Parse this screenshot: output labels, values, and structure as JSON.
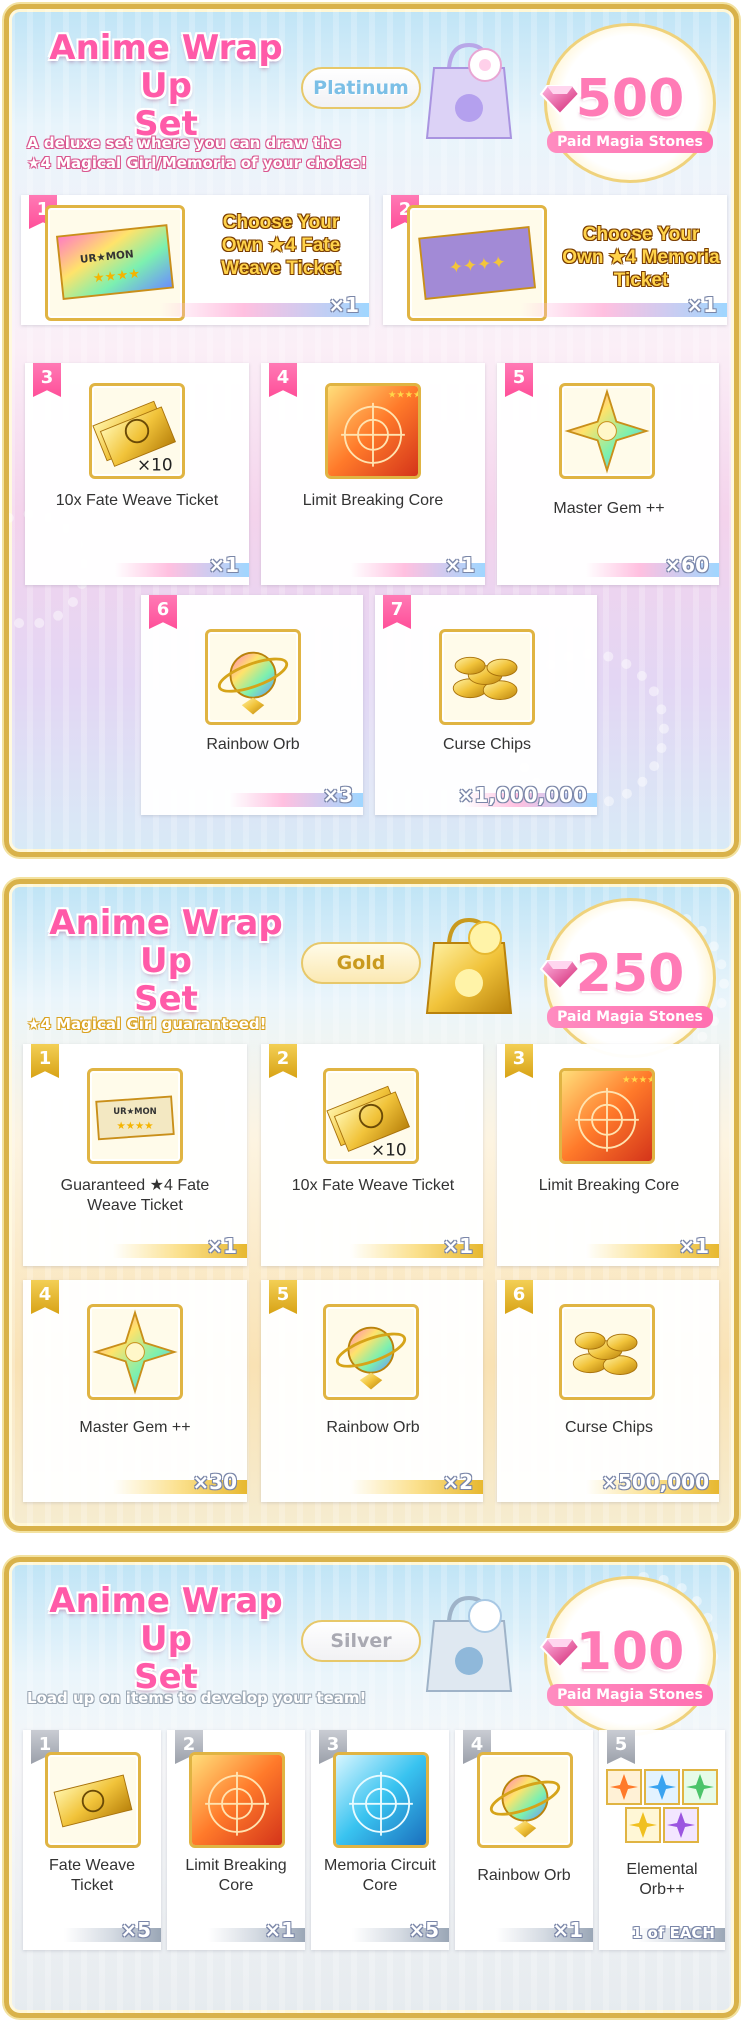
{
  "platinum": {
    "title_line1": "Anime Wrap Up",
    "title_line2": "Set",
    "tier": "Platinum",
    "price": "500",
    "price_label": "Paid Magia Stones",
    "description_line1": "A deluxe set where you can draw the",
    "description_line2": "★4 Magical Girl/Memoria of your choice!",
    "items": [
      {
        "num": "1",
        "label": "Choose Your Own ★4 Fate Weave Ticket",
        "qty": "×1"
      },
      {
        "num": "2",
        "label": "Choose Your Own ★4 Memoria Ticket",
        "qty": "×1"
      },
      {
        "num": "3",
        "label": "10x Fate Weave Ticket",
        "qty": "×1",
        "icon_badge": "×10"
      },
      {
        "num": "4",
        "label": "Limit Breaking Core",
        "qty": "×1"
      },
      {
        "num": "5",
        "label": "Master Gem ++",
        "qty": "×60"
      },
      {
        "num": "6",
        "label": "Rainbow Orb",
        "qty": "×3"
      },
      {
        "num": "7",
        "label": "Curse Chips",
        "qty": "×1,000,000"
      }
    ]
  },
  "gold": {
    "title_line1": "Anime Wrap Up",
    "title_line2": "Set",
    "tier": "Gold",
    "price": "250",
    "price_label": "Paid Magia Stones",
    "description": "★4 Magical Girl guaranteed!",
    "items": [
      {
        "num": "1",
        "label": "Guaranteed ★4 Fate Weave Ticket",
        "qty": "×1"
      },
      {
        "num": "2",
        "label": "10x Fate Weave Ticket",
        "qty": "×1",
        "icon_badge": "×10"
      },
      {
        "num": "3",
        "label": "Limit Breaking Core",
        "qty": "×1"
      },
      {
        "num": "4",
        "label": "Master Gem ++",
        "qty": "×30"
      },
      {
        "num": "5",
        "label": "Rainbow Orb",
        "qty": "×2"
      },
      {
        "num": "6",
        "label": "Curse Chips",
        "qty": "×500,000"
      }
    ]
  },
  "silver": {
    "title_line1": "Anime Wrap Up",
    "title_line2": "Set",
    "tier": "Silver",
    "price": "100",
    "price_label": "Paid Magia Stones",
    "description": "Load up on items to develop your team!",
    "items": [
      {
        "num": "1",
        "label": "Fate Weave Ticket",
        "qty": "×5"
      },
      {
        "num": "2",
        "label": "Limit Breaking Core",
        "qty": "×1"
      },
      {
        "num": "3",
        "label": "Memoria Circuit Core",
        "qty": "×5"
      },
      {
        "num": "4",
        "label": "Rainbow Orb",
        "qty": "×1"
      },
      {
        "num": "5",
        "label": "Elemental Orb++",
        "qty": "1 of EACH"
      }
    ]
  },
  "ticket_stamp": "UR★MON",
  "colors": {
    "pink": "#ff5aa8",
    "gold": "#d9b24a",
    "sky": "#bfe4f6"
  },
  "icons": [
    "gem-icon",
    "bag-icon",
    "ticket-icon",
    "core-icon",
    "master-gem-icon",
    "rainbow-orb-icon",
    "curse-chips-icon",
    "memoria-core-icon",
    "elemental-orb-icon"
  ]
}
